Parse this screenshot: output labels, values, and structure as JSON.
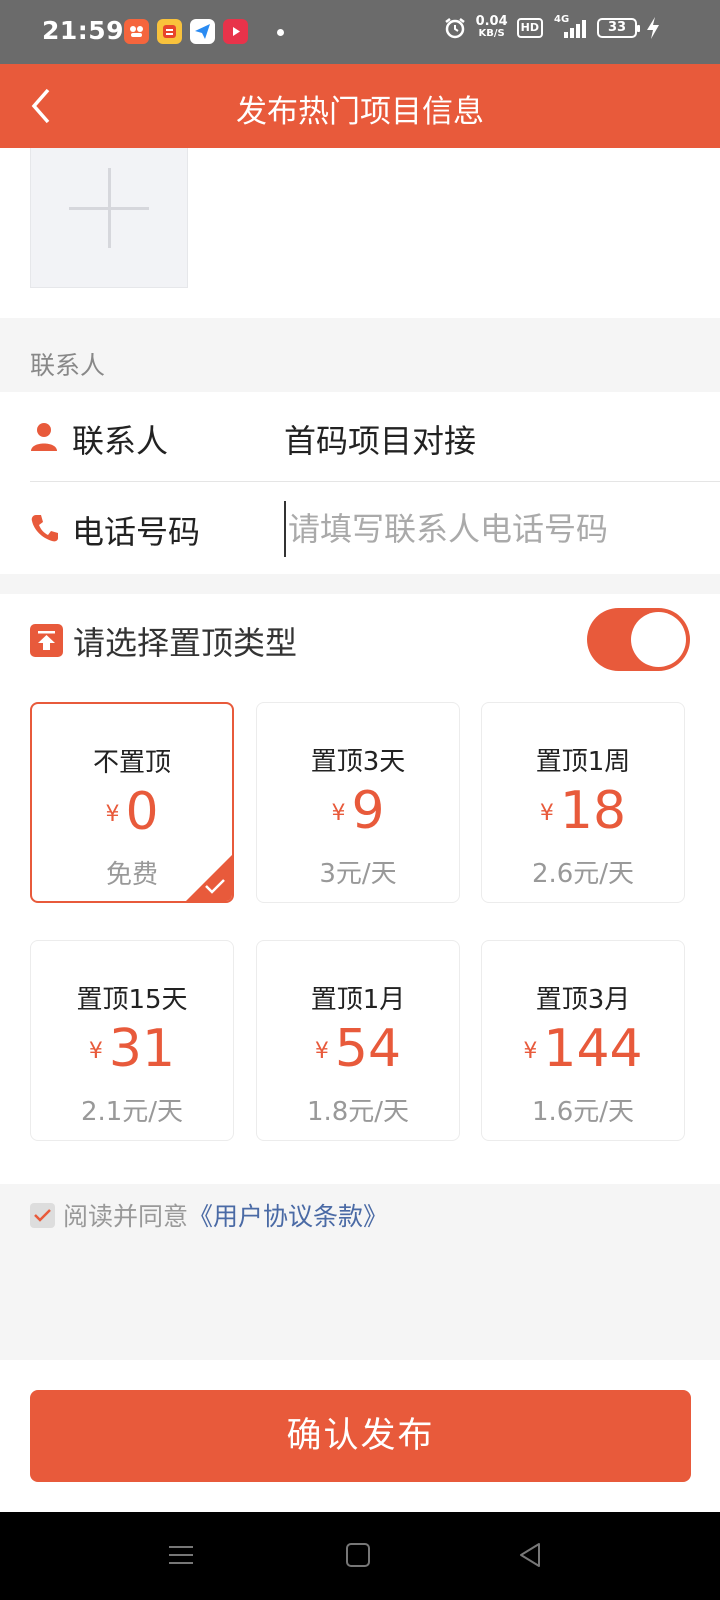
{
  "status_bar": {
    "time": "21:59",
    "net_speed_value": "0.04",
    "net_speed_unit": "KB/S",
    "hd_badge": "HD",
    "network_type": "4G",
    "battery_level": "33"
  },
  "navbar": {
    "title": "发布热门项目信息"
  },
  "contact": {
    "section_title": "联系人",
    "name_label": "联系人",
    "name_value": "首码项目对接",
    "phone_label": "电话号码",
    "phone_placeholder": "请填写联系人电话号码"
  },
  "top_type": {
    "header_label": "请选择置顶类型",
    "toggle_on": true,
    "currency_symbol": "¥",
    "plans": [
      {
        "name": "不置顶",
        "price": "0",
        "per_day": "免费",
        "selected": true
      },
      {
        "name": "置顶3天",
        "price": "9",
        "per_day": "3元/天",
        "selected": false
      },
      {
        "name": "置顶1周",
        "price": "18",
        "per_day": "2.6元/天",
        "selected": false
      },
      {
        "name": "置顶15天",
        "price": "31",
        "per_day": "2.1元/天",
        "selected": false
      },
      {
        "name": "置顶1月",
        "price": "54",
        "per_day": "1.8元/天",
        "selected": false
      },
      {
        "name": "置顶3月",
        "price": "144",
        "per_day": "1.6元/天",
        "selected": false
      }
    ]
  },
  "agreement": {
    "text": "阅读并同意",
    "link_text": "《用户协议条款》",
    "checked": true
  },
  "confirm_button": {
    "label": "确认发布"
  },
  "colors": {
    "accent": "#e85a3b",
    "status_bar": "#6b6b6b",
    "link": "#4a6aa5"
  }
}
